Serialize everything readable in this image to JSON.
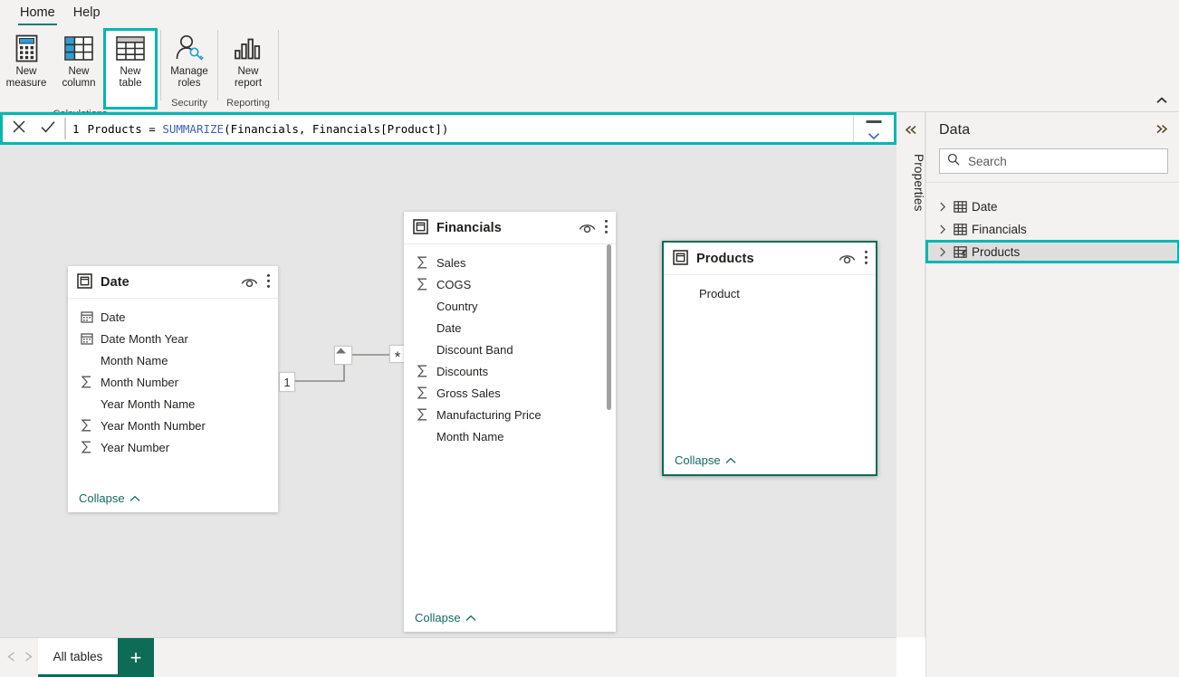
{
  "ribbon": {
    "tabs": [
      {
        "label": "Home",
        "active": true
      },
      {
        "label": "Help",
        "active": false
      }
    ],
    "groups": [
      {
        "label": "Calculations",
        "buttons": [
          {
            "label": "New\nmeasure",
            "icon": "new-measure-icon",
            "highlighted": false
          },
          {
            "label": "New\ncolumn",
            "icon": "new-column-icon",
            "highlighted": false
          },
          {
            "label": "New\ntable",
            "icon": "new-table-icon",
            "highlighted": true
          }
        ]
      },
      {
        "label": "Security",
        "buttons": [
          {
            "label": "Manage\nroles",
            "icon": "manage-roles-icon",
            "highlighted": false
          }
        ]
      },
      {
        "label": "Reporting",
        "buttons": [
          {
            "label": "New\nreport",
            "icon": "new-report-icon",
            "highlighted": false
          }
        ]
      }
    ],
    "collapse_icon": "chevron-up-icon"
  },
  "formula_bar": {
    "cancel_icon": "close-icon",
    "commit_icon": "checkmark-icon",
    "line_number": "1",
    "expression_prefix": "Products = ",
    "expression_function": "SUMMARIZE",
    "expression_suffix": "(Financials, Financials[Product])",
    "full_expression": "Products = SUMMARIZE(Financials, Financials[Product])",
    "minimize_icon": "minimize-icon",
    "expand_icon": "chevron-down-icon",
    "highlight_color": "#00B7B3"
  },
  "properties_rail": {
    "label": "Properties",
    "collapse_icon": "chevron-double-left-icon"
  },
  "canvas": {
    "background": "#e6e6e6",
    "tables": [
      {
        "name": "Date",
        "icon": "table-icon",
        "selected": false,
        "eye_icon": "eye-icon",
        "more_icon": "more-vertical-icon",
        "collapse_label": "Collapse",
        "collapse_icon": "chevron-up-icon",
        "has_scrollbar": false,
        "fields": [
          {
            "name": "Date",
            "icon": "calendar-icon"
          },
          {
            "name": "Date Month Year",
            "icon": "calendar-icon"
          },
          {
            "name": "Month Name",
            "icon": "none"
          },
          {
            "name": "Month Number",
            "icon": "sigma-icon"
          },
          {
            "name": "Year Month Name",
            "icon": "none"
          },
          {
            "name": "Year Month Number",
            "icon": "sigma-icon"
          },
          {
            "name": "Year Number",
            "icon": "sigma-icon"
          }
        ]
      },
      {
        "name": "Financials",
        "icon": "table-icon",
        "selected": false,
        "eye_icon": "eye-icon",
        "more_icon": "more-vertical-icon",
        "collapse_label": "Collapse",
        "collapse_icon": "chevron-up-icon",
        "has_scrollbar": true,
        "fields": [
          {
            "name": "Sales",
            "icon": "sigma-icon"
          },
          {
            "name": "COGS",
            "icon": "sigma-icon"
          },
          {
            "name": "Country",
            "icon": "none"
          },
          {
            "name": "Date",
            "icon": "none"
          },
          {
            "name": "Discount Band",
            "icon": "none"
          },
          {
            "name": "Discounts",
            "icon": "sigma-icon"
          },
          {
            "name": "Gross Sales",
            "icon": "sigma-icon"
          },
          {
            "name": "Manufacturing Price",
            "icon": "sigma-icon"
          },
          {
            "name": "Month Name",
            "icon": "none"
          }
        ]
      },
      {
        "name": "Products",
        "icon": "table-icon",
        "selected": true,
        "eye_icon": "eye-icon",
        "more_icon": "more-vertical-icon",
        "collapse_label": "Collapse",
        "collapse_icon": "chevron-up-icon",
        "has_scrollbar": false,
        "fields": [
          {
            "name": "Product",
            "icon": "none"
          }
        ]
      }
    ],
    "relationship": {
      "from_cardinality": "1",
      "to_cardinality": "*",
      "direction_icon": "filter-arrow-icon"
    }
  },
  "bottom_bar": {
    "prev_icon": "triangle-left-icon",
    "next_icon": "triangle-right-icon",
    "tabs": [
      {
        "label": "All tables",
        "active": true
      }
    ],
    "add_label": "+",
    "add_color": "#0e6b55"
  },
  "data_pane": {
    "title": "Data",
    "expand_icon": "chevron-double-right-icon",
    "search_icon": "search-icon",
    "search_placeholder": "Search",
    "search_value": "",
    "items": [
      {
        "label": "Date",
        "icon": "table-icon",
        "chevron": "chevron-right-icon",
        "highlighted": false
      },
      {
        "label": "Financials",
        "icon": "table-icon",
        "chevron": "chevron-right-icon",
        "highlighted": false
      },
      {
        "label": "Products",
        "icon": "calculated-table-icon",
        "chevron": "chevron-right-icon",
        "highlighted": true
      }
    ],
    "highlight_color": "#00B7B3"
  }
}
